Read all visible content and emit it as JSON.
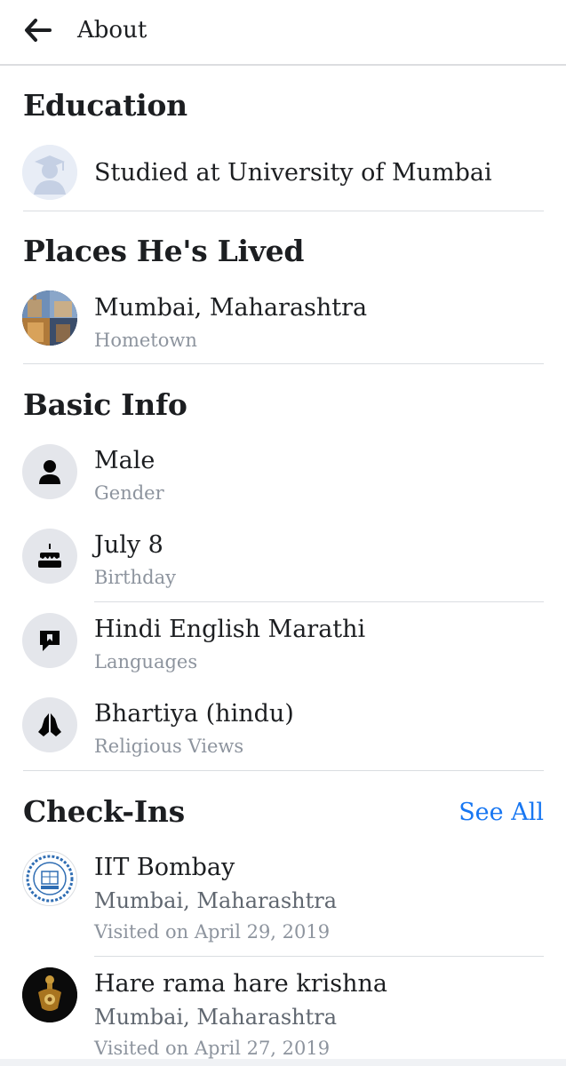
{
  "header": {
    "title": "About"
  },
  "education": {
    "title": "Education",
    "items": [
      {
        "text": "Studied at University of Mumbai",
        "icon": "graduate-avatar-icon"
      }
    ]
  },
  "places": {
    "title": "Places He's Lived",
    "items": [
      {
        "text": "Mumbai, Maharashtra",
        "caption": "Hometown",
        "icon": "city-photo-thumbnail"
      }
    ]
  },
  "basic_info": {
    "title": "Basic Info",
    "items": [
      {
        "text": "Male",
        "caption": "Gender",
        "icon": "person-icon"
      },
      {
        "text": "July 8",
        "caption": "Birthday",
        "icon": "cake-icon"
      },
      {
        "text": "Hindi English Marathi",
        "caption": "Languages",
        "icon": "speech-bubble-icon"
      },
      {
        "text": "Bhartiya (hindu)",
        "caption": "Religious Views",
        "icon": "praying-hands-icon"
      }
    ]
  },
  "checkins": {
    "title": "Check-Ins",
    "see_all": "See All",
    "accent": "#1877f2",
    "items": [
      {
        "name": "IIT Bombay",
        "location": "Mumbai, Maharashtra",
        "visited": "Visited on April 29, 2019",
        "icon": "iit-bombay-logo"
      },
      {
        "name": "Hare rama hare krishna",
        "location": "Mumbai, Maharashtra",
        "visited": "Visited on April 27, 2019",
        "icon": "temple-logo"
      }
    ]
  }
}
